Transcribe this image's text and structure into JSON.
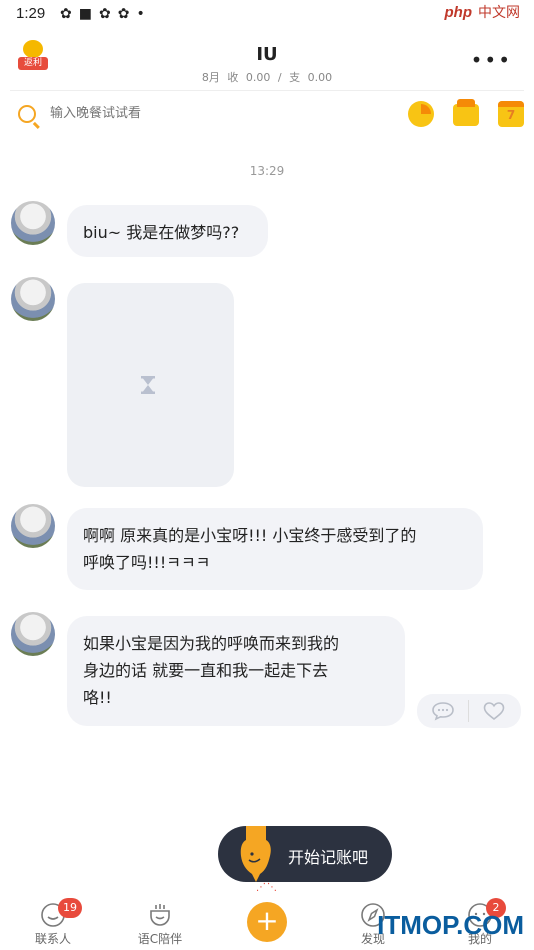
{
  "status_bar": {
    "time": "1:29",
    "watermark_logo": "php",
    "watermark_text": "中文网"
  },
  "header": {
    "promo_label": "返利",
    "title": "IU",
    "month": "8月",
    "income_label": "收",
    "income_value": "0.00",
    "separator": "/",
    "expense_label": "支",
    "expense_value": "0.00",
    "more": "•••"
  },
  "search": {
    "placeholder": "输入晚餐试试看"
  },
  "tools": {
    "calendar_day": "7"
  },
  "chat": {
    "timestamp": "13:29",
    "messages": [
      {
        "type": "text",
        "text": "biu~ 我是在做梦吗??"
      },
      {
        "type": "image"
      },
      {
        "type": "text",
        "lines": [
          "啊啊 原来真的是小宝呀!!! 小宝终于感受到了的",
          "呼唤了吗!!!ㅋㅋㅋ"
        ]
      },
      {
        "type": "text",
        "lines": [
          "如果小宝是因为我的呼唤而来到我的",
          "身边的话 就要一直和我一起走下去",
          "咯!!"
        ]
      }
    ]
  },
  "tooltip": {
    "label": "开始记账吧"
  },
  "nav": {
    "items": [
      {
        "label": "联系人",
        "badge": "19"
      },
      {
        "label": "语C陪伴"
      },
      {
        "label": "发现"
      },
      {
        "label": "我的",
        "badge": "2"
      }
    ],
    "add_symbol": "+"
  },
  "watermark": {
    "text": "ITMOP.COM"
  },
  "colors": {
    "accent": "#f5a623",
    "bubble": "#f2f3f7",
    "badge": "#e84a3c",
    "tooltip": "#2c3240"
  }
}
